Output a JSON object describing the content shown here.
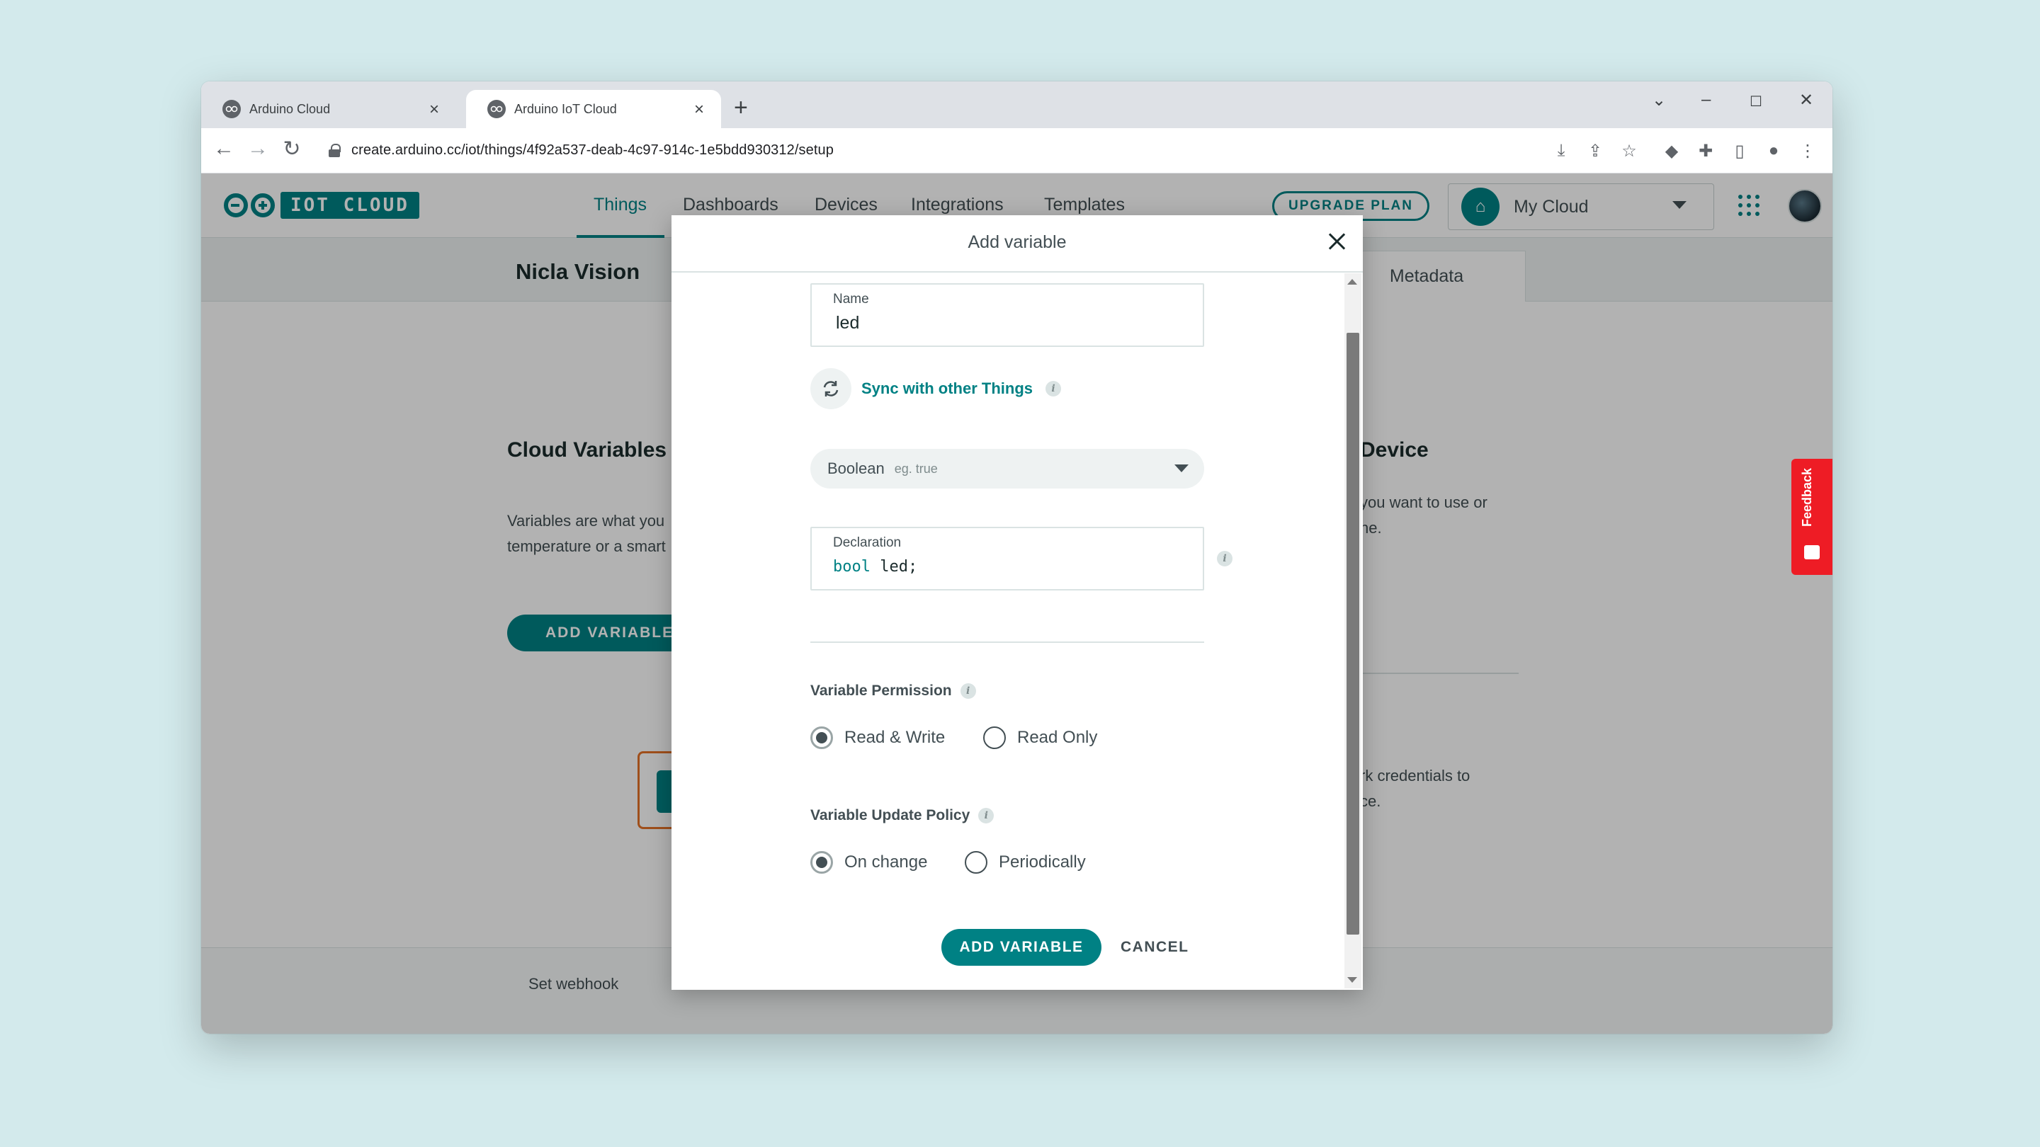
{
  "browser": {
    "tabs": [
      {
        "label": "Arduino Cloud"
      },
      {
        "label": "Arduino IoT Cloud"
      }
    ],
    "url": "create.arduino.cc/iot/things/4f92a537-deab-4c97-914c-1e5bdd930312/setup"
  },
  "app": {
    "logo_text": "IOT CLOUD",
    "nav": [
      "Things",
      "Dashboards",
      "Devices",
      "Integrations",
      "Templates"
    ],
    "active_nav": "Things",
    "upgrade_label": "UPGRADE PLAN",
    "space_label": "My Cloud",
    "accent_color": "#008184"
  },
  "page": {
    "thing_name": "Nicla Vision",
    "metadata_tab": "Metadata",
    "cloud_variables_title": "Cloud Variables",
    "cloud_variables_text_1": "Variables are what you",
    "cloud_variables_text_2": "temperature or a smart",
    "add_variable_bg": "ADD VARIABLE",
    "device_title": "Device",
    "device_text_1": "you want to use or",
    "device_text_2": "ne.",
    "network_text_1": "rk credentials to",
    "network_text_2": "ce.",
    "webhook_label": "Set webhook",
    "feedback_label": "Feedback"
  },
  "modal": {
    "title": "Add variable",
    "name_label": "Name",
    "name_value": "led",
    "sync_label": "Sync with other Things",
    "type_value": "Boolean",
    "type_hint": "eg. true",
    "declaration_label": "Declaration",
    "declaration_type": "bool",
    "declaration_name": "led",
    "declaration_end": ";",
    "permission_title": "Variable Permission",
    "permission_options": [
      "Read & Write",
      "Read Only"
    ],
    "permission_selected": "Read & Write",
    "policy_title": "Variable Update Policy",
    "policy_options": [
      "On change",
      "Periodically"
    ],
    "policy_selected": "On change",
    "submit_label": "ADD VARIABLE",
    "cancel_label": "CANCEL"
  }
}
